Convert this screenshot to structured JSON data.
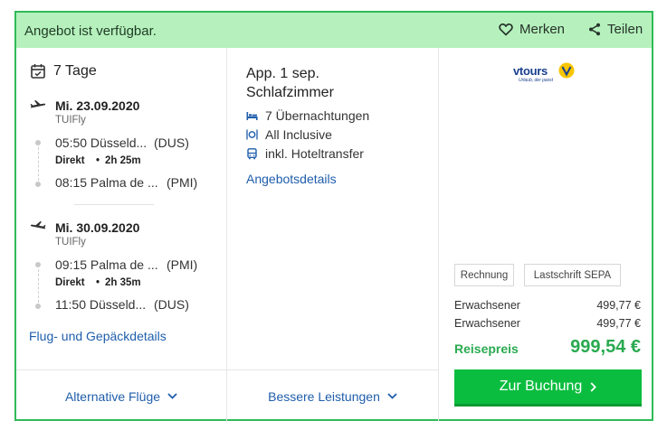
{
  "header": {
    "availability": "Angebot ist verfügbar.",
    "save_label": "Merken",
    "share_label": "Teilen"
  },
  "flight": {
    "duration": "7 Tage",
    "outbound": {
      "date": "Mi. 23.09.2020",
      "airline": "TUIFly",
      "dep_time_place": "05:50 Düsseld...",
      "dep_code": "(DUS)",
      "direct": "Direkt",
      "flight_time": "2h 25m",
      "arr_time_place": "08:15 Palma de ...",
      "arr_code": "(PMI)"
    },
    "inbound": {
      "date": "Mi. 30.09.2020",
      "airline": "TUIFly",
      "dep_time_place": "09:15 Palma de ...",
      "dep_code": "(PMI)",
      "direct": "Direkt",
      "flight_time": "2h 35m",
      "arr_time_place": "11:50 Düsseld...",
      "arr_code": "(DUS)"
    },
    "details_link": "Flug- und Gepäckdetails"
  },
  "hotel": {
    "room": "App. 1 sep. Schlafzimmer",
    "nights": "7 Übernachtungen",
    "board": "All Inclusive",
    "transfer": "inkl. Hoteltransfer",
    "details_link": "Angebotsdetails"
  },
  "price": {
    "operator": "vtours",
    "operator_tagline": "Urlaub, der passt",
    "payment_methods": [
      "Rechnung",
      "Lastschrift SEPA"
    ],
    "travelers": [
      {
        "label": "Erwachsener",
        "price": "499,77 €"
      },
      {
        "label": "Erwachsener",
        "price": "499,77 €"
      }
    ],
    "total_label": "Reisepreis",
    "total": "999,54 €",
    "book_label": "Zur Buchung"
  },
  "footer": {
    "alt_flights": "Alternative Flüge",
    "better_services": "Bessere Leistungen"
  },
  "colors": {
    "accent_green": "#0bbd3f",
    "header_bg": "#b6f1bd",
    "link_blue": "#1f5eab",
    "operator_yellow": "#f7c600",
    "operator_blue": "#1a3f8f"
  }
}
